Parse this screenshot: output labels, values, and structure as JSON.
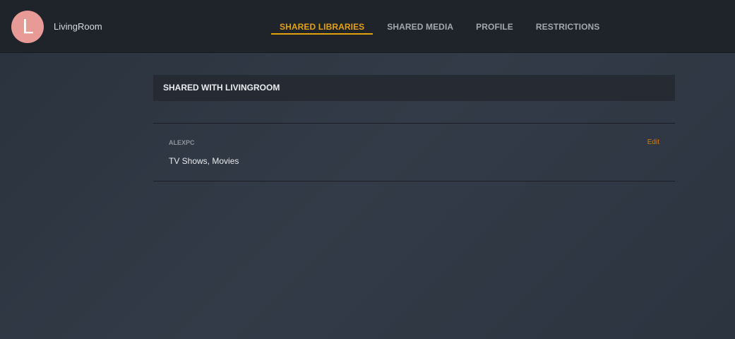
{
  "user": {
    "avatar_letter": "L",
    "name": "LivingRoom"
  },
  "tabs": [
    {
      "label": "SHARED LIBRARIES",
      "active": true
    },
    {
      "label": "SHARED MEDIA",
      "active": false
    },
    {
      "label": "PROFILE",
      "active": false
    },
    {
      "label": "RESTRICTIONS",
      "active": false
    }
  ],
  "section": {
    "title": "SHARED WITH LIVINGROOM"
  },
  "servers": [
    {
      "name": "ALEXPC",
      "libraries": "TV Shows, Movies",
      "edit_label": "Edit"
    }
  ],
  "colors": {
    "accent": "#e5a00d",
    "edit_link": "#cc7b19",
    "avatar_bg": "#e89a97"
  }
}
